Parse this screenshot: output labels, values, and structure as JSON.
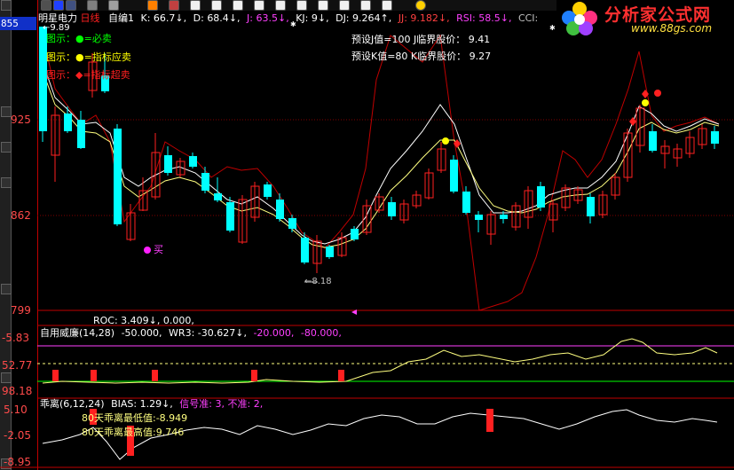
{
  "toolbar": {
    "left_marker": "855"
  },
  "header": {
    "stock_name": "明星电力",
    "period": "日线",
    "indicator": "自编1",
    "items": [
      {
        "label": "K: 66.7",
        "arrow": "↓",
        "color": "#ffffff"
      },
      {
        "label": "D: 68.4",
        "arrow": "↓",
        "color": "#ffffff"
      },
      {
        "label": "J: 63.5",
        "arrow": "↓",
        "color": "#ff40ff"
      },
      {
        "label": "KJ: 9",
        "arrow": "↓",
        "color": "#ffffff"
      },
      {
        "label": "DJ: 9.264",
        "arrow": "↑",
        "color": "#ffffff"
      },
      {
        "label": "JJ: 9.182",
        "arrow": "↓",
        "color": "#ff4040"
      },
      {
        "label": "RSI: 58.5",
        "arrow": "↓",
        "color": "#ff40ff"
      },
      {
        "label": "CCI:",
        "arrow": "",
        "color": "#c0c0c0"
      }
    ]
  },
  "logo": {
    "title": "分析家公式网",
    "url": "www.88gs.com"
  },
  "legend": [
    {
      "prefix": "图示：",
      "symbol": "●",
      "symbol_color": "#00ff00",
      "text": "=必卖"
    },
    {
      "prefix": "图示：",
      "symbol": "●",
      "symbol_color": "#ffff00",
      "text": "=指标应卖"
    },
    {
      "prefix": "图示：",
      "symbol": "◆",
      "symbol_color": "#ff2020",
      "text": "=指标超卖"
    }
  ],
  "preset": {
    "line1": "预设J值=100 J临界股价： 9.41",
    "line2": "预设K值=80 K临界股价： 9.27"
  },
  "price_axis": [
    "925",
    "862",
    "799"
  ],
  "annotations": {
    "high_label": "9.89",
    "low_label": "8.18",
    "buy_label": "买"
  },
  "roc": {
    "text": "ROC: 3.409↓, 0.000,"
  },
  "williams": {
    "title": "自用威廉(14,28)",
    "v1": "-50.000,",
    "wr3": "WR3: -30.627↓,",
    "v2": "-20.000,",
    "v3": "-80.000,"
  },
  "williams_axis": [
    "-5.83",
    "52.77",
    "98.18"
  ],
  "bias": {
    "title": "乖离(6,12,24)",
    "value": "BIAS: 1.29↓,",
    "signal": "信号准: 3, 不准: 2,",
    "low": "80天乖离最低值:-8.949",
    "high": "80天乖离最高值:9.746"
  },
  "bias_axis": [
    "5.10",
    "-2.05",
    "-8.95"
  ],
  "colors": {
    "up": "#ff2020",
    "down": "#00ffff",
    "ma_white": "#ffffff",
    "ma_yellow": "#ffff80",
    "kline_red": "#c00000"
  }
}
